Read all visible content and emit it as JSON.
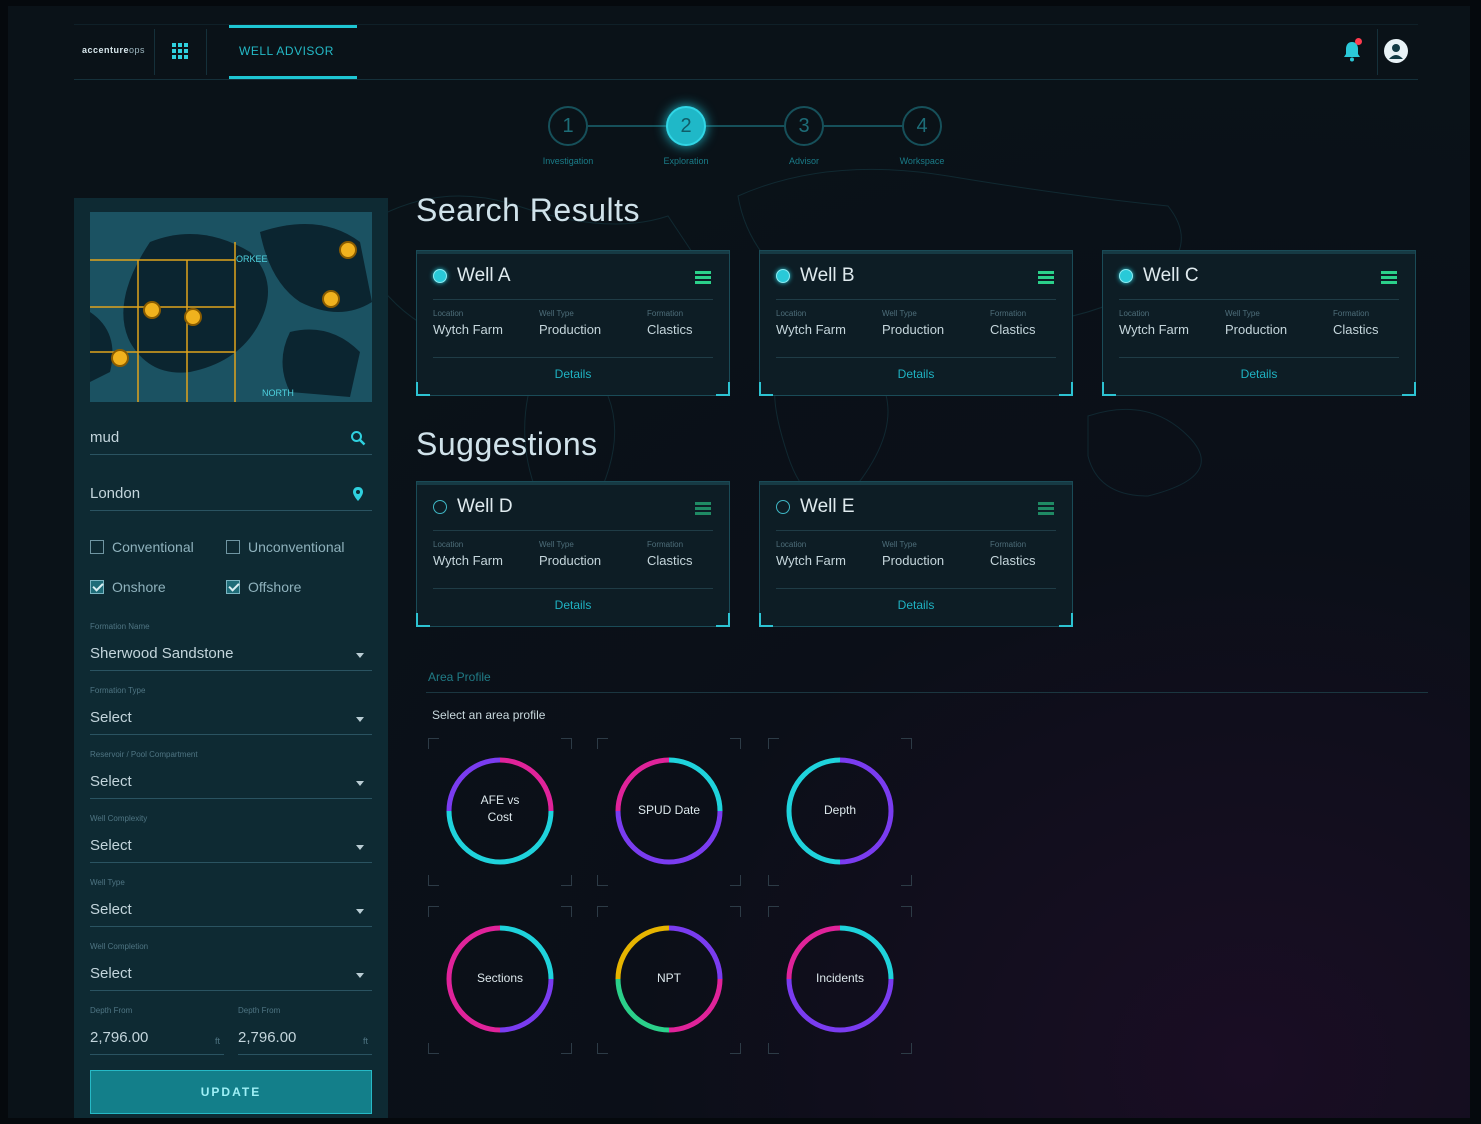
{
  "header": {
    "logo": "accenture",
    "logo_suffix": "ops",
    "active_tab": "WELL ADVISOR"
  },
  "stepper": {
    "steps": [
      {
        "number": "1",
        "label": "Investigation",
        "active": false
      },
      {
        "number": "2",
        "label": "Exploration",
        "active": true
      },
      {
        "number": "3",
        "label": "Advisor",
        "active": false
      },
      {
        "number": "4",
        "label": "Workspace",
        "active": false
      }
    ]
  },
  "sidebar": {
    "map_labels": [
      "ORKEE",
      "NORTH"
    ],
    "search": {
      "value": "mud",
      "icon": "search-icon"
    },
    "location": {
      "value": "London",
      "icon": "location-pin-icon"
    },
    "checkboxes": [
      {
        "label": "Conventional",
        "checked": false
      },
      {
        "label": "Unconventional",
        "checked": false
      },
      {
        "label": "Onshore",
        "checked": true
      },
      {
        "label": "Offshore",
        "checked": true
      }
    ],
    "selects": [
      {
        "caption": "Formation Name",
        "value": "Sherwood Sandstone"
      },
      {
        "caption": "Formation Type",
        "value": "Select"
      },
      {
        "caption": "Reservoir / Pool Compartment",
        "value": "Select"
      },
      {
        "caption": "Well Complexity",
        "value": "Select"
      },
      {
        "caption": "Well Type",
        "value": "Select"
      },
      {
        "caption": "Well Completion",
        "value": "Select"
      }
    ],
    "depth_from": {
      "caption": "Depth From",
      "value": "2,796.00",
      "unit": "ft"
    },
    "depth_to": {
      "caption": "Depth From",
      "value": "2,796.00",
      "unit": "ft"
    },
    "update_label": "UPDATE"
  },
  "search_results": {
    "heading": "Search Results",
    "wells": [
      {
        "name": "Well A",
        "selected": true,
        "location_caption": "Location",
        "location": "Wytch Farm",
        "type_caption": "Well Type",
        "type": "Production",
        "formation_caption": "Formation",
        "formation": "Clastics",
        "details": "Details"
      },
      {
        "name": "Well B",
        "selected": true,
        "location_caption": "Location",
        "location": "Wytch Farm",
        "type_caption": "Well Type",
        "type": "Production",
        "formation_caption": "Formation",
        "formation": "Clastics",
        "details": "Details"
      },
      {
        "name": "Well C",
        "selected": true,
        "location_caption": "Location",
        "location": "Wytch Farm",
        "type_caption": "Well Type",
        "type": "Production",
        "formation_caption": "Formation",
        "formation": "Clastics",
        "details": "Details"
      }
    ]
  },
  "suggestions": {
    "heading": "Suggestions",
    "wells": [
      {
        "name": "Well D",
        "selected": false,
        "location_caption": "Location",
        "location": "Wytch Farm",
        "type_caption": "Well Type",
        "type": "Production",
        "formation_caption": "Formation",
        "formation": "Clastics",
        "details": "Details"
      },
      {
        "name": "Well E",
        "selected": false,
        "location_caption": "Location",
        "location": "Wytch Farm",
        "type_caption": "Well Type",
        "type": "Production",
        "formation_caption": "Formation",
        "formation": "Clastics",
        "details": "Details"
      }
    ]
  },
  "area_profile": {
    "title": "Area Profile",
    "subtitle": "Select an area profile",
    "tiles": [
      {
        "line1": "AFE vs",
        "line2": "Cost"
      },
      {
        "line1": "SPUD Date",
        "line2": ""
      },
      {
        "line1": "Depth",
        "line2": ""
      },
      {
        "line1": "Sections",
        "line2": ""
      },
      {
        "line1": "NPT",
        "line2": ""
      },
      {
        "line1": "Incidents",
        "line2": ""
      }
    ]
  },
  "colors": {
    "accent": "#1ec6d3",
    "panel": "#0e2a33",
    "alert": "#ff3b4f",
    "ring_magenta": "#e0239a",
    "ring_cyan": "#1fd3dc",
    "ring_violet": "#7a3cf0",
    "ring_yellow": "#e6b400",
    "map_marker": "#f0b21e"
  }
}
